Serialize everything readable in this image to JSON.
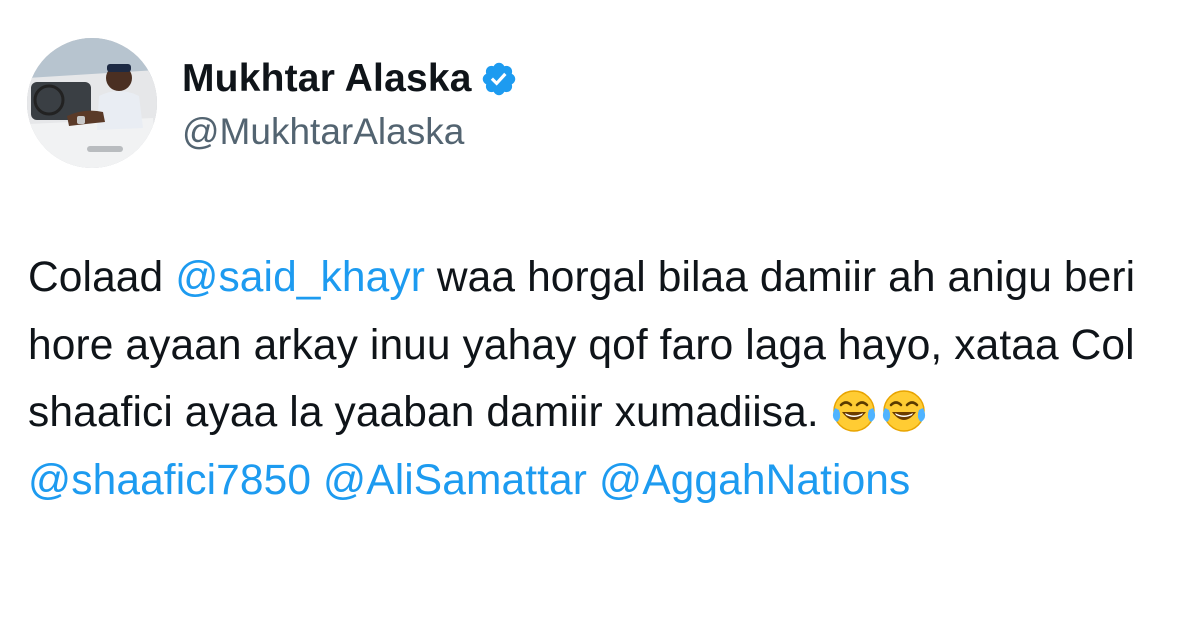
{
  "tweet": {
    "author": {
      "display_name": "Mukhtar Alaska",
      "handle": "@MukhtarAlaska",
      "verified": true,
      "verified_color": "#1d9bf0",
      "avatar_icon": "profile-photo"
    },
    "text": {
      "part1": "Colaad ",
      "mention1": "@said_khayr",
      "part2": " waa horgal bilaa damiir ah anigu beri hore ayaan arkay inuu yahay qof faro laga hayo, xataa Col shaafici ayaa la yaaban damiir xumadiisa. ",
      "emoji_icon": "face-with-tears-of-joy-icon",
      "space": " ",
      "mention2": "@shaafici7850",
      "mention3": "@AliSamattar",
      "mention4": "@AggahNations"
    },
    "colors": {
      "text": "#0f1419",
      "secondary": "#536471",
      "link": "#1d9bf0",
      "background": "#ffffff"
    }
  }
}
